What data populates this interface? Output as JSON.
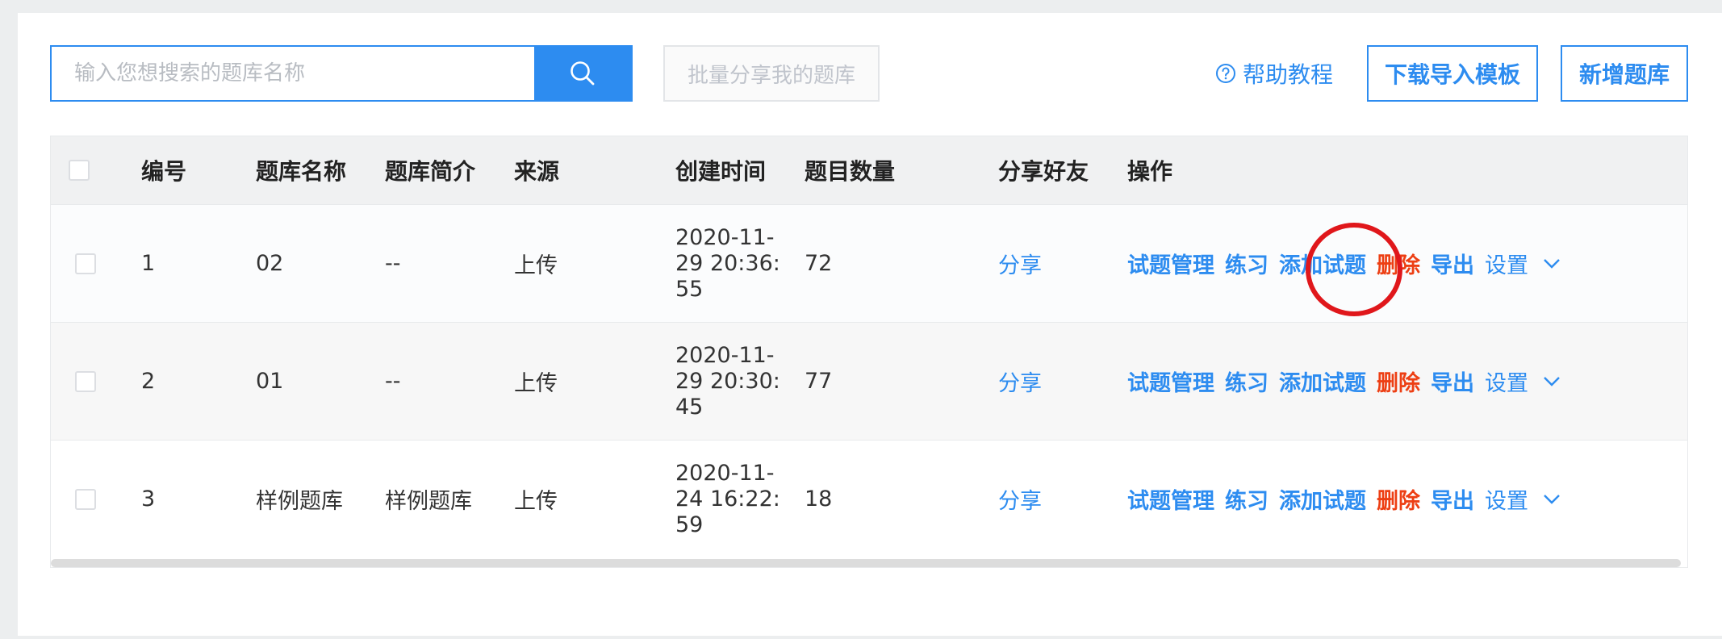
{
  "toolbar": {
    "search_placeholder": "输入您想搜索的题库名称",
    "batch_share_label": "批量分享我的题库",
    "help_label": "帮助教程",
    "download_template_label": "下载导入模板",
    "new_bank_label": "新增题库"
  },
  "colors": {
    "accent": "#2d8cf0",
    "danger": "#ed3f14",
    "annotation": "#e0171b"
  },
  "table": {
    "headers": {
      "id": "编号",
      "name": "题库名称",
      "intro": "题库简介",
      "source": "来源",
      "created": "创建时间",
      "count": "题目数量",
      "share": "分享好友",
      "ops": "操作"
    },
    "rows": [
      {
        "id": "1",
        "name": "02",
        "intro": "--",
        "source": "上传",
        "created": "2020-11-\n29 20:36:\n55",
        "count": "72",
        "share": "分享"
      },
      {
        "id": "2",
        "name": "01",
        "intro": "--",
        "source": "上传",
        "created": "2020-11-\n29 20:30:\n45",
        "count": "77",
        "share": "分享"
      },
      {
        "id": "3",
        "name": "样例题库",
        "intro": "样例题库",
        "source": "上传",
        "created": "2020-11-\n24 16:22:\n59",
        "count": "18",
        "share": "分享"
      }
    ],
    "actions": {
      "manage": "试题管理",
      "practice": "练习",
      "add": "添加试题",
      "delete": "删除",
      "export": "导出",
      "settings": "设置"
    }
  }
}
